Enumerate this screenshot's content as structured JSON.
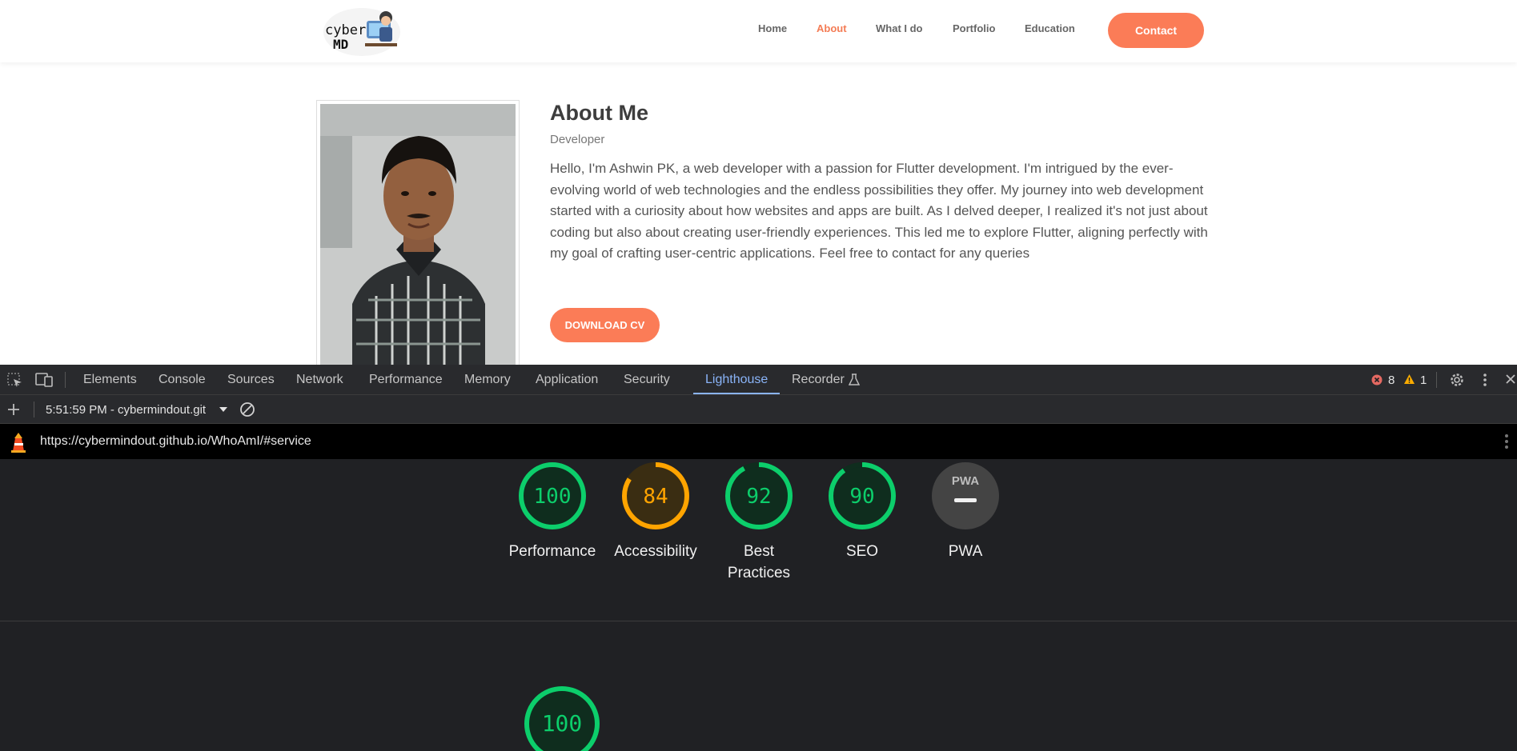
{
  "site": {
    "logo_line1": "cyber",
    "logo_line2": "MD",
    "nav": [
      {
        "label": "Home",
        "active": false
      },
      {
        "label": "About",
        "active": true
      },
      {
        "label": "What I do",
        "active": false
      },
      {
        "label": "Portfolio",
        "active": false
      },
      {
        "label": "Education",
        "active": false
      }
    ],
    "contact_label": "Contact",
    "about": {
      "title": "About Me",
      "subtitle": "Developer",
      "body": "Hello, I'm Ashwin PK, a web developer with a passion for Flutter development. I'm intrigued by the ever-evolving world of web technologies and the endless possibilities they offer. My journey into web development started with a curiosity about how websites and apps are built. As I delved deeper, I realized it's not just about coding but also about creating user-friendly experiences. This led me to explore Flutter, aligning perfectly with my goal of crafting user-centric applications. Feel free to contact for any queries",
      "cv_label": "DOWNLOAD CV"
    },
    "accent_color": "#fb7c57"
  },
  "devtools": {
    "tabs": [
      "Elements",
      "Console",
      "Sources",
      "Network",
      "Performance",
      "Memory",
      "Application",
      "Security",
      "Lighthouse",
      "Recorder"
    ],
    "active_tab": "Lighthouse",
    "errors": "8",
    "warnings": "1",
    "report_selector": "5:51:59 PM - cybermindout.git",
    "url": "https://cybermindout.github.io/WhoAmI/#service",
    "gauges": [
      {
        "label": "Performance",
        "score": "100",
        "color": "#0cce6b"
      },
      {
        "label": "Accessibility",
        "score": "84",
        "color": "#ffa400"
      },
      {
        "label": "Best Practices",
        "score": "92",
        "color": "#0cce6b"
      },
      {
        "label": "SEO",
        "score": "90",
        "color": "#0cce6b"
      },
      {
        "label": "PWA",
        "score": "",
        "color": "#9e9e9e",
        "badge": "PWA"
      }
    ],
    "performance_score": "100"
  }
}
